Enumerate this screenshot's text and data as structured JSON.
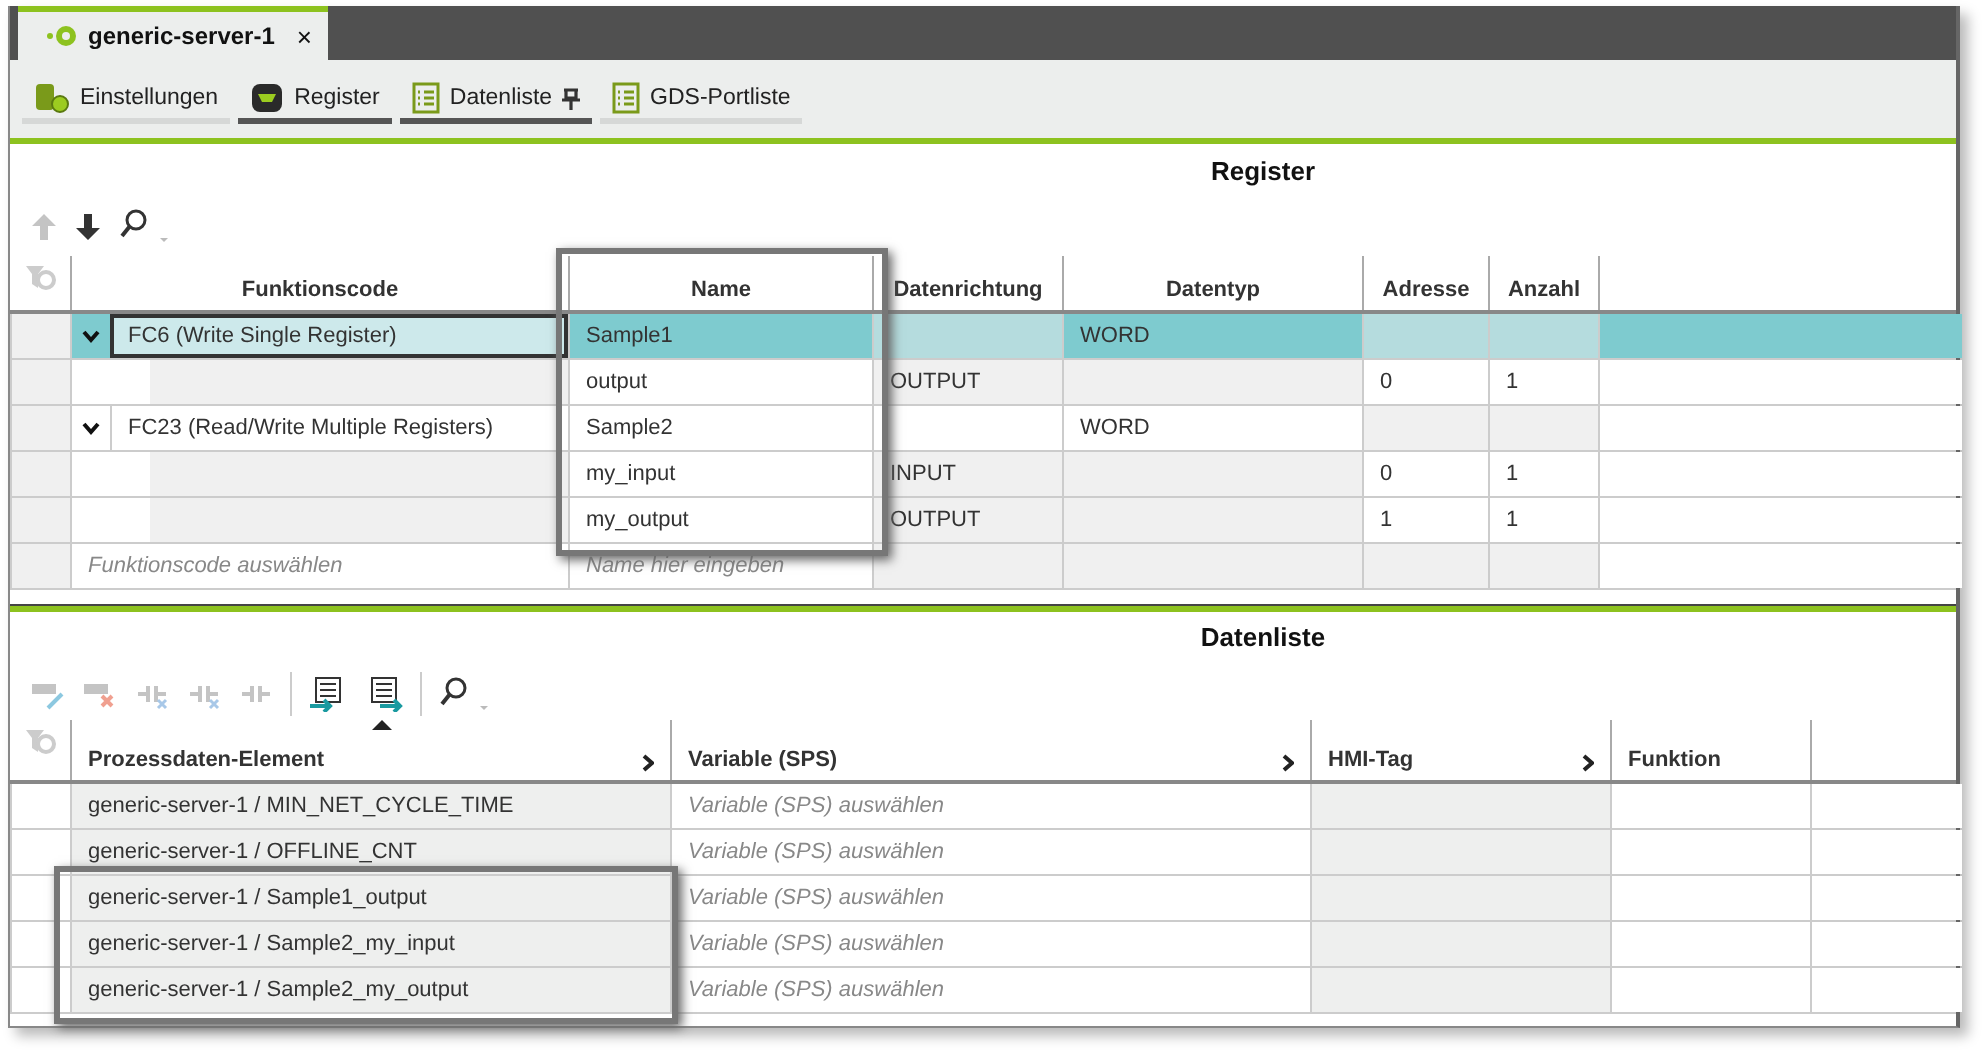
{
  "tab": {
    "title": "generic-server-1",
    "close": "×"
  },
  "views": [
    {
      "label": "Einstellungen",
      "open": false,
      "pinned": false
    },
    {
      "label": "Register",
      "open": true,
      "pinned": false
    },
    {
      "label": "Datenliste",
      "open": true,
      "pinned": true
    },
    {
      "label": "GDS-Portliste",
      "open": false,
      "pinned": false
    }
  ],
  "register": {
    "title": "Register",
    "toolbar": [
      {
        "kind": "up",
        "disabled": true
      },
      {
        "kind": "down",
        "disabled": false
      },
      {
        "kind": "search",
        "disabled": false
      }
    ],
    "columns": [
      {
        "label": "Funktionscode",
        "highlighted": false
      },
      {
        "label": "Name",
        "highlighted": true
      },
      {
        "label": "Datenrichtung",
        "highlighted": false
      },
      {
        "label": "Datentyp",
        "highlighted": false
      },
      {
        "label": "Adresse",
        "highlighted": false
      },
      {
        "label": "Anzahl",
        "highlighted": false
      }
    ],
    "rows": [
      {
        "kind": "group",
        "expanded": true,
        "selected": true,
        "cells": [
          "FC6 (Write Single Register)",
          "Sample1",
          "",
          "WORD",
          "",
          ""
        ]
      },
      {
        "kind": "item",
        "selected": false,
        "cells": [
          "",
          "output",
          "OUTPUT",
          "",
          "0",
          "1"
        ]
      },
      {
        "kind": "group",
        "expanded": true,
        "selected": false,
        "cells": [
          "FC23 (Read/Write Multiple Registers)",
          "Sample2",
          "",
          "WORD",
          "",
          ""
        ]
      },
      {
        "kind": "item",
        "selected": false,
        "cells": [
          "",
          "my_input",
          "INPUT",
          "",
          "0",
          "1"
        ]
      },
      {
        "kind": "item",
        "selected": false,
        "cells": [
          "",
          "my_output",
          "OUTPUT",
          "",
          "1",
          "1"
        ]
      }
    ],
    "new_row": {
      "function_placeholder": "Funktionscode auswählen",
      "name_placeholder": "Name hier eingeben"
    }
  },
  "datenliste": {
    "title": "Datenliste",
    "toolbar": [
      {
        "kind": "hmi-edit",
        "disabled": true
      },
      {
        "kind": "hmi-delete",
        "disabled": true
      },
      {
        "kind": "link",
        "disabled": true
      },
      {
        "kind": "unlink",
        "disabled": true
      },
      {
        "kind": "connect",
        "disabled": true
      },
      {
        "kind": "csv-import",
        "disabled": false
      },
      {
        "kind": "csv-export",
        "disabled": false
      },
      {
        "kind": "search",
        "disabled": false
      }
    ],
    "columns": [
      {
        "label": "Prozessdaten-Element",
        "expandable": true,
        "sorted": true
      },
      {
        "label": "Variable (SPS)",
        "expandable": true,
        "sorted": false
      },
      {
        "label": "HMI-Tag",
        "expandable": true,
        "sorted": false
      },
      {
        "label": "Funktion",
        "expandable": false,
        "sorted": false
      }
    ],
    "rows": [
      {
        "element": "generic-server-1 / MIN_NET_CYCLE_TIME",
        "variable": "Variable (SPS) auswählen",
        "highlighted": false
      },
      {
        "element": "generic-server-1 / OFFLINE_CNT",
        "variable": "Variable (SPS) auswählen",
        "highlighted": false
      },
      {
        "element": "generic-server-1 / Sample1_output",
        "variable": "Variable (SPS) auswählen",
        "highlighted": true
      },
      {
        "element": "generic-server-1 / Sample2_my_input",
        "variable": "Variable (SPS) auswählen",
        "highlighted": true
      },
      {
        "element": "generic-server-1 / Sample2_my_output",
        "variable": "Variable (SPS) auswählen",
        "highlighted": true
      }
    ]
  }
}
